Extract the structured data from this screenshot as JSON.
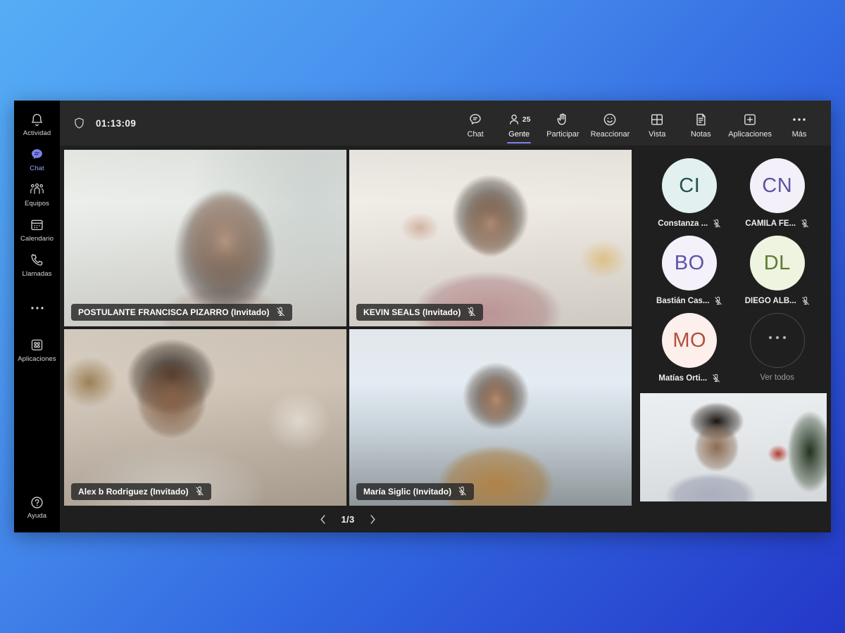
{
  "rail": {
    "items": [
      {
        "label": "Actividad",
        "icon": "bell-icon",
        "active": false
      },
      {
        "label": "Chat",
        "icon": "chat-bubble-icon",
        "active": true
      },
      {
        "label": "Equipos",
        "icon": "teams-people-icon",
        "active": false
      },
      {
        "label": "Calendario",
        "icon": "calendar-icon",
        "active": false
      },
      {
        "label": "Llamadas",
        "icon": "phone-icon",
        "active": false
      },
      {
        "label": "",
        "icon": "more-dots-icon",
        "active": false
      },
      {
        "label": "Aplicaciones",
        "icon": "apps-grid-icon",
        "active": false
      }
    ],
    "help": {
      "label": "Ayuda",
      "icon": "help-circle-icon"
    }
  },
  "topbar": {
    "shield_icon": "shield-icon",
    "timer": "01:13:09",
    "tools": [
      {
        "label": "Chat",
        "icon": "chat-icon",
        "badge": "",
        "active": false
      },
      {
        "label": "Gente",
        "icon": "people-icon",
        "badge": "25",
        "active": true
      },
      {
        "label": "Participar",
        "icon": "raise-hand-icon",
        "badge": "",
        "active": false
      },
      {
        "label": "Reaccionar",
        "icon": "smiley-icon",
        "badge": "",
        "active": false
      },
      {
        "label": "Vista",
        "icon": "view-grid-icon",
        "badge": "",
        "active": false
      },
      {
        "label": "Notas",
        "icon": "notes-icon",
        "badge": "",
        "active": false
      },
      {
        "label": "Aplicaciones",
        "icon": "apps-plus-icon",
        "badge": "",
        "active": false
      },
      {
        "label": "Más",
        "icon": "more-horizontal-icon",
        "badge": "",
        "active": false
      }
    ]
  },
  "stage": {
    "tiles": [
      {
        "name": "POSTULANTE FRANCISCA PIZARRO (Invitado)",
        "muted": true,
        "bg": "bg-francisca"
      },
      {
        "name": "KEVIN SEALS (Invitado)",
        "muted": true,
        "bg": "bg-kevin"
      },
      {
        "name": "Alex b Rodriguez (Invitado)",
        "muted": true,
        "bg": "bg-alex"
      },
      {
        "name": "María Siglic (Invitado)",
        "muted": true,
        "bg": "bg-maria"
      }
    ],
    "pagination": {
      "prev_icon": "chevron-left-icon",
      "next_icon": "chevron-right-icon",
      "indicator": "1/3"
    }
  },
  "roster": {
    "participants": [
      {
        "initials": "CI",
        "name": "Constanza ...",
        "muted": true,
        "bg": "#e2f1f0",
        "fg": "#24514f"
      },
      {
        "initials": "CN",
        "name": "CAMILA FE...",
        "muted": true,
        "bg": "#f4f0fa",
        "fg": "#5b54a4"
      },
      {
        "initials": "BO",
        "name": "Bastián Cas...",
        "muted": true,
        "bg": "#f5f1fb",
        "fg": "#5b54a4"
      },
      {
        "initials": "DL",
        "name": "DIEGO ALB...",
        "muted": true,
        "bg": "#eef4e0",
        "fg": "#5f7a34"
      },
      {
        "initials": "MO",
        "name": "Matías Orti...",
        "muted": true,
        "bg": "#fcefec",
        "fg": "#b34f3a"
      }
    ],
    "see_all": {
      "label": "Ver todos",
      "icon": "more-dots-icon"
    }
  },
  "self_view": {
    "name": "self-video",
    "bg": "bg-self"
  }
}
